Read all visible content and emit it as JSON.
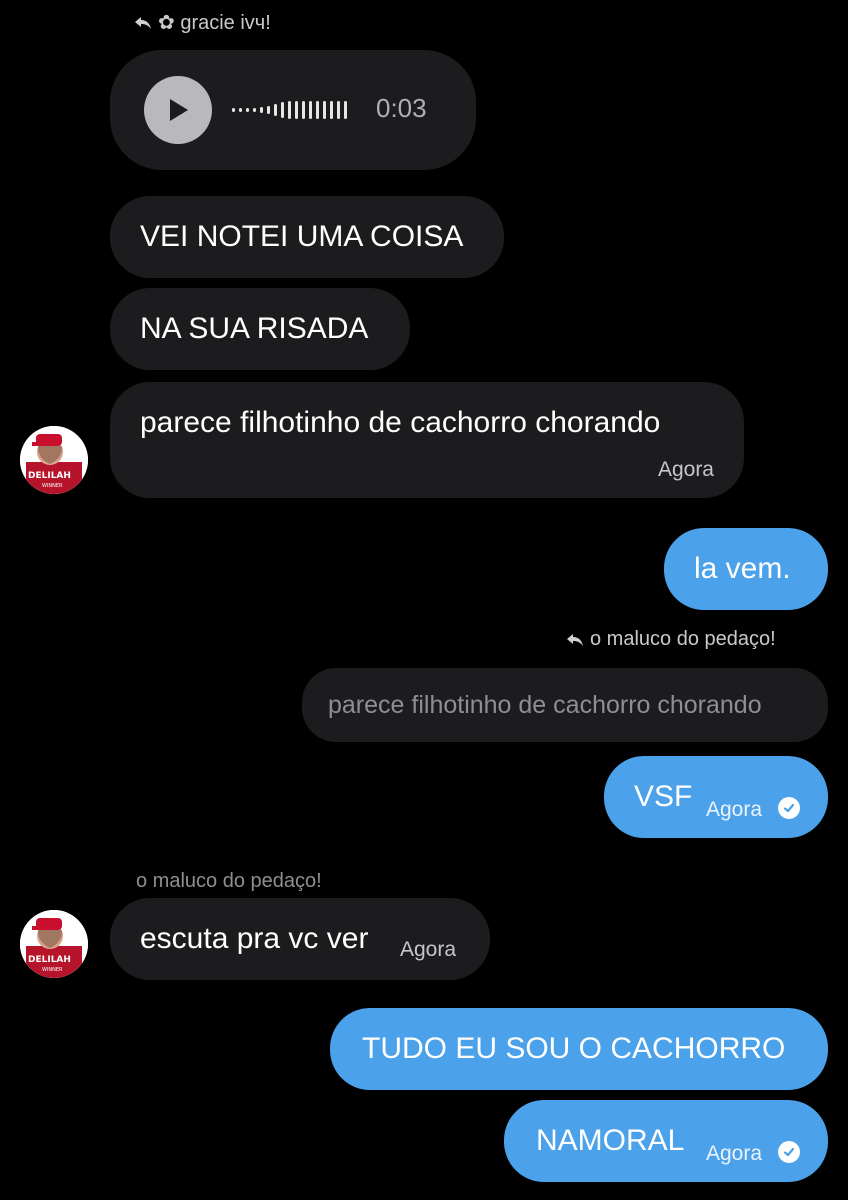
{
  "reply_header_top": {
    "name": "✿ gracie ivч!"
  },
  "voice_message": {
    "duration": "0:03"
  },
  "messages_in_1": [
    {
      "text": "VEI NOTEI UMA COISA"
    },
    {
      "text": "NA SUA RISADA"
    },
    {
      "text": "parece filhotinho de cachorro chorando",
      "time": "Agora"
    }
  ],
  "message_out_1": {
    "text": "la vem."
  },
  "reply_header_mid": {
    "name": "o maluco do pedaço!"
  },
  "quoted_message": {
    "text": "parece filhotinho de cachorro chorando"
  },
  "message_out_2": {
    "text": "VSF",
    "time": "Agora"
  },
  "sender_label": {
    "name": "o maluco do pedaço!"
  },
  "message_in_2": {
    "text": "escuta pra vc ver",
    "time": "Agora"
  },
  "message_out_3": {
    "text": "TUDO EU SOU O CACHORRO"
  },
  "message_out_4": {
    "text": "NAMORAL",
    "time": "Agora"
  },
  "avatar_text": {
    "line1": "DELILAH",
    "line2": "WINNER"
  },
  "colors": {
    "background": "#000000",
    "bubble_incoming": "#1c1c1e",
    "bubble_outgoing": "#4ba1ea",
    "muted_text": "#8e8e93"
  }
}
